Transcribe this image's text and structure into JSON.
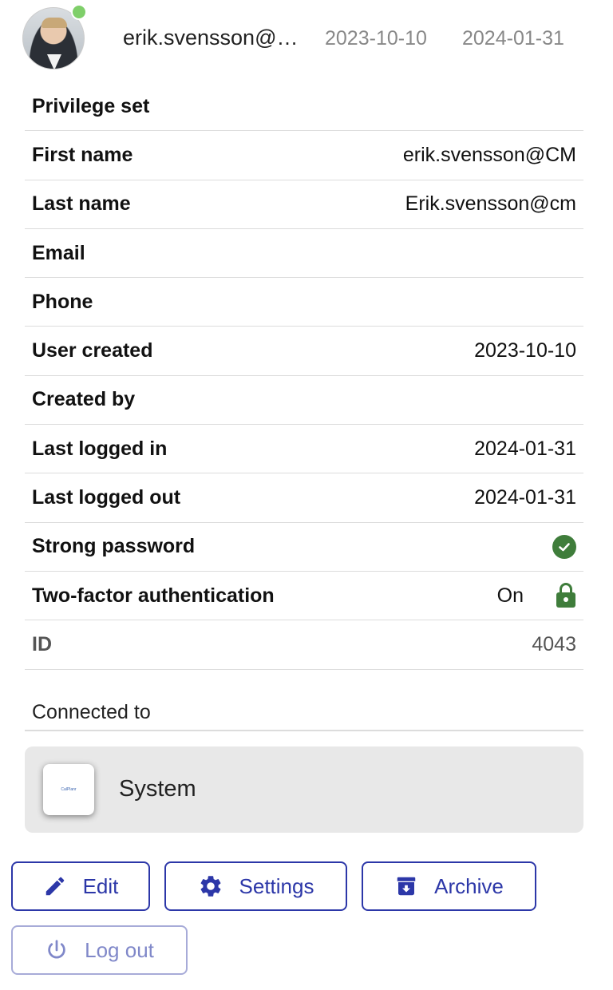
{
  "header": {
    "username": "erik.svensson@…",
    "created_date": "2023-10-10",
    "last_login_date": "2024-01-31",
    "online_status_color": "#7fcf6a"
  },
  "details": {
    "privilege_set": {
      "label": "Privilege set",
      "value": ""
    },
    "first_name": {
      "label": "First name",
      "value": "erik.svensson@CM"
    },
    "last_name": {
      "label": "Last name",
      "value": "Erik.svensson@cm"
    },
    "email": {
      "label": "Email",
      "value": ""
    },
    "phone": {
      "label": "Phone",
      "value": ""
    },
    "user_created": {
      "label": "User created",
      "value": "2023-10-10"
    },
    "created_by": {
      "label": "Created by",
      "value": ""
    },
    "last_logged_in": {
      "label": "Last logged in",
      "value": "2024-01-31"
    },
    "last_logged_out": {
      "label": "Last logged out",
      "value": "2024-01-31"
    },
    "strong_password": {
      "label": "Strong password",
      "icon": "check-circle-icon"
    },
    "two_factor": {
      "label": "Two-factor authentication",
      "value": "On",
      "icon": "lock-icon"
    },
    "id": {
      "label": "ID",
      "value": "4043"
    }
  },
  "connected": {
    "label": "Connected to",
    "system_name": "System",
    "logo_text": "CalPlanr"
  },
  "actions": {
    "edit_label": "Edit",
    "settings_label": "Settings",
    "archive_label": "Archive",
    "logout_label": "Log out"
  },
  "colors": {
    "accent": "#2c37a8",
    "success": "#3f7d3b",
    "card_bg": "#e8e8e8"
  }
}
